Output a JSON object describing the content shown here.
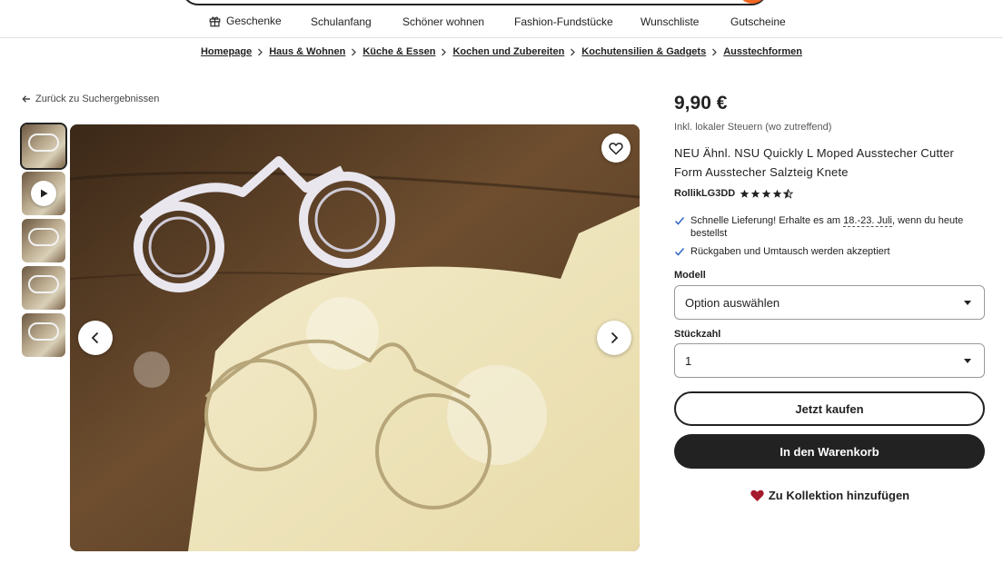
{
  "header": {
    "nav": [
      {
        "label": "Geschenke",
        "icon": "gift-icon"
      },
      {
        "label": "Schulanfang"
      },
      {
        "label": "Schöner wohnen"
      },
      {
        "label": "Fashion-Fundstücke"
      },
      {
        "label": "Wunschliste"
      },
      {
        "label": "Gutscheine"
      }
    ]
  },
  "breadcrumb": [
    "Homepage",
    "Haus & Wohnen",
    "Küche & Essen",
    "Kochen und Zubereiten",
    "Kochutensilien & Gadgets",
    "Ausstechformen"
  ],
  "back_link": "Zurück zu Suchergebnissen",
  "gallery": {
    "thumbnail_count": 5,
    "active_index": 0,
    "video_thumbnail_index": 1
  },
  "product": {
    "price": "9,90 €",
    "tax_note": "Inkl. lokaler Steuern (wo zutreffend)",
    "title": "NEU Ähnl. NSU Quickly L Moped Ausstecher Cutter Form Ausstecher Salzteig Knete",
    "shop_name": "RollikLG3DD",
    "rating": 4.5,
    "perks": {
      "delivery_prefix": "Schnelle Lieferung! Erhalte es am ",
      "delivery_date": "18.-23. Juli",
      "delivery_suffix": ", wenn du heute bestellst",
      "returns": "Rückgaben und Umtausch werden akzeptiert"
    },
    "model_label": "Modell",
    "model_value": "Option auswählen",
    "quantity_label": "Stückzahl",
    "quantity_value": "1",
    "buy_now": "Jetzt kaufen",
    "add_to_cart": "In den Warenkorb",
    "add_to_collection": "Zu Kollektion hinzufügen"
  },
  "colors": {
    "accent": "#f1641e",
    "primary_button": "#222222",
    "check": "#2f66c6",
    "heart": "#a61a2e"
  }
}
